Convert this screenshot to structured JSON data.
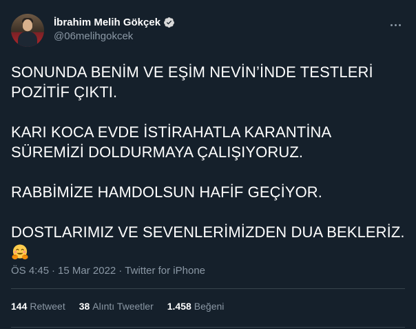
{
  "author": {
    "display_name": "İbrahim Melih Gökçek",
    "handle": "@06melihgokcek",
    "verified_icon": "verified-badge-icon",
    "avatar_icon": "avatar"
  },
  "tweet": {
    "paragraphs": [
      "SONUNDA BENİM VE EŞİM NEVİN’İNDE TESTLERİ POZİTİF ÇIKTI.",
      "KARI KOCA EVDE İSTİRAHATLA KARANTİNA SÜREMİZİ DOLDURMAYA ÇALIŞIYORUZ.",
      "RABBİMİZE HAMDOLSUN   HAFİF GEÇİYOR.",
      "DOSTLARIMIZ VE SEVENLERİMİZDEN DUA BEKLERİZ."
    ],
    "emoji": "hugging-face-emoji"
  },
  "meta": {
    "time": "ÖS 4:45",
    "separator": "·",
    "date": "15 Mar 2022",
    "source": "Twitter for iPhone"
  },
  "stats": {
    "retweets_count": "144",
    "retweets_label": "Retweet",
    "quotes_count": "38",
    "quotes_label": "Alıntı Tweetler",
    "likes_count": "1.458",
    "likes_label": "Beğeni"
  },
  "colors": {
    "background": "#15202b",
    "text": "#ffffff",
    "secondary": "#8b98a5",
    "divider": "#38444d",
    "verified": "#d9d9d9"
  }
}
